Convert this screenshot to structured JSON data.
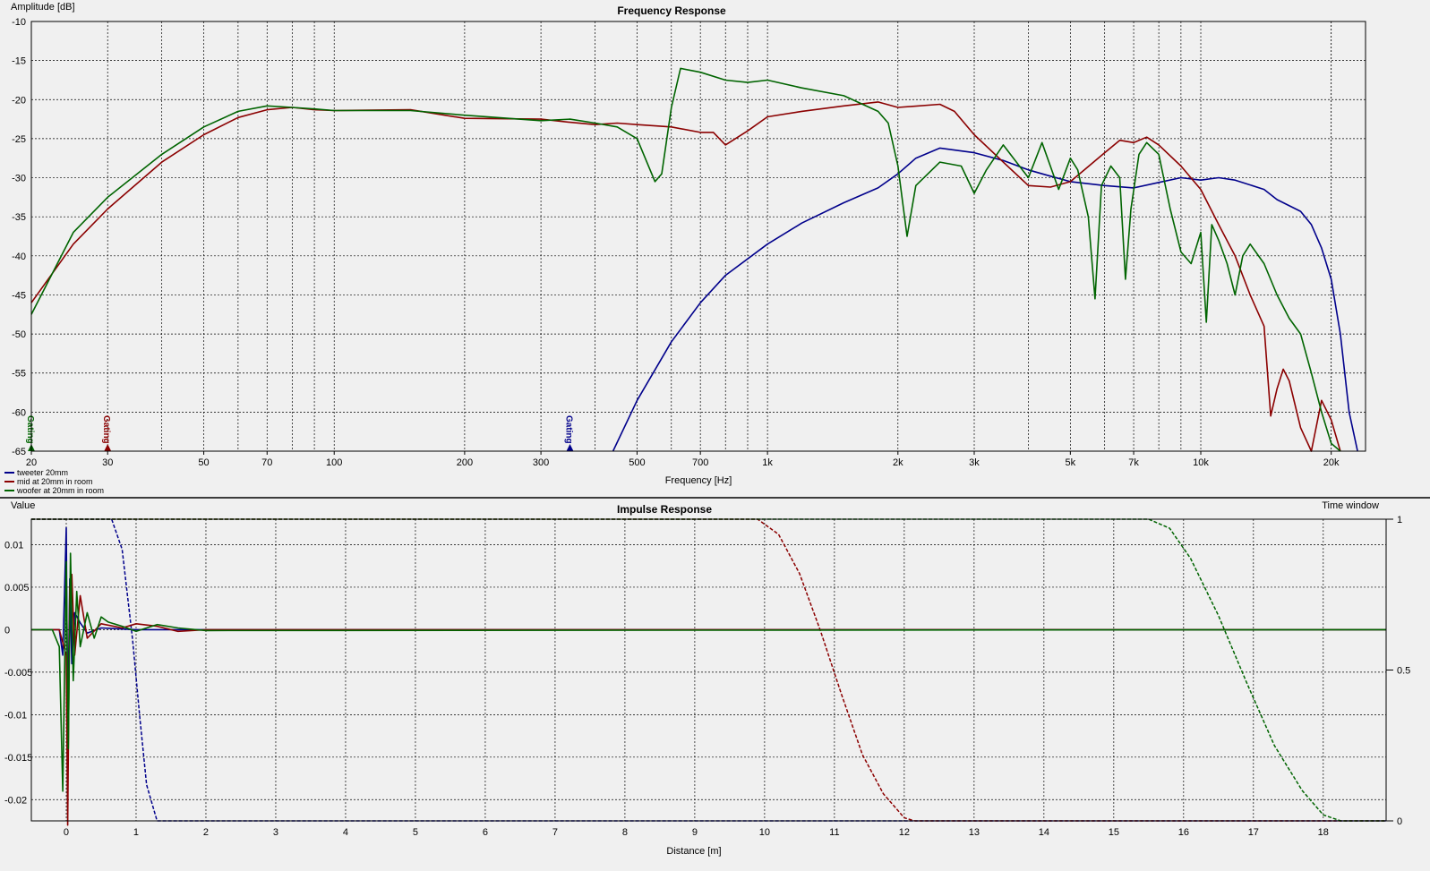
{
  "colors": {
    "tweeter": "#00008b",
    "mid": "#8b0000",
    "woofer": "#006400",
    "background": "#f0f0f0"
  },
  "chart_data": [
    {
      "type": "line",
      "title": "Frequency Response",
      "xlabel": "Frequency [Hz]",
      "ylabel": "Amplitude [dB]",
      "xscale": "log",
      "xlim": [
        20,
        24000
      ],
      "ylim": [
        -65,
        -10
      ],
      "xticks": [
        20,
        30,
        50,
        70,
        100,
        200,
        300,
        500,
        700,
        1000,
        2000,
        3000,
        5000,
        7000,
        10000,
        20000
      ],
      "xticklabels": [
        "20",
        "30",
        "50",
        "70",
        "100",
        "200",
        "300",
        "500",
        "700",
        "1k",
        "2k",
        "3k",
        "5k",
        "7k",
        "10k",
        "20k"
      ],
      "yticks": [
        -10,
        -15,
        -20,
        -25,
        -30,
        -35,
        -40,
        -45,
        -50,
        -55,
        -60,
        -65
      ],
      "grid": true,
      "legend_position": "bottom-left",
      "series": [
        {
          "name": "tweeter 20mm",
          "color": "#00008b",
          "x": [
            440,
            500,
            600,
            700,
            800,
            1000,
            1200,
            1500,
            1800,
            2000,
            2200,
            2500,
            3000,
            3500,
            4000,
            4500,
            5000,
            6000,
            7000,
            8000,
            9000,
            10000,
            11000,
            12000,
            14000,
            15000,
            17000,
            18000,
            19000,
            20000,
            21000,
            22000,
            23000
          ],
          "y": [
            -65,
            -58.5,
            -51,
            -46,
            -42.5,
            -38.5,
            -35.8,
            -33.2,
            -31.3,
            -29.5,
            -27.5,
            -26.2,
            -26.8,
            -27.8,
            -29,
            -29.8,
            -30.5,
            -31,
            -31.3,
            -30.6,
            -30,
            -30.3,
            -30,
            -30.3,
            -31.5,
            -32.8,
            -34.3,
            -36,
            -39,
            -43,
            -50,
            -60,
            -65
          ]
        },
        {
          "name": "mid at 20mm in room",
          "color": "#8b0000",
          "x": [
            20,
            25,
            30,
            40,
            50,
            60,
            70,
            80,
            90,
            100,
            150,
            200,
            300,
            350,
            400,
            450,
            500,
            600,
            700,
            750,
            800,
            900,
            1000,
            1200,
            1500,
            1800,
            2000,
            2500,
            2700,
            3000,
            3500,
            4000,
            4500,
            5000,
            6000,
            6500,
            7000,
            7500,
            8000,
            9000,
            10000,
            11000,
            12000,
            13000,
            14000,
            14500,
            15000,
            15500,
            16000,
            17000,
            18000,
            19000,
            20000,
            21000
          ],
          "y": [
            -46,
            -38.5,
            -34,
            -28,
            -24.5,
            -22.3,
            -21.3,
            -21,
            -21.3,
            -21.4,
            -21.3,
            -22.4,
            -22.5,
            -22.9,
            -23.2,
            -23,
            -23.2,
            -23.5,
            -24.2,
            -24.2,
            -25.8,
            -24,
            -22.2,
            -21.5,
            -20.8,
            -20.3,
            -21,
            -20.6,
            -21.5,
            -24.5,
            -28,
            -31,
            -31.2,
            -30.5,
            -26.8,
            -25.2,
            -25.5,
            -24.8,
            -25.8,
            -28.5,
            -31.5,
            -36,
            -40,
            -45,
            -49,
            -60.5,
            -57,
            -54.5,
            -56,
            -62,
            -65,
            -58.5,
            -61,
            -65
          ]
        },
        {
          "name": "woofer at 20mm in room",
          "color": "#006400",
          "x": [
            20,
            25,
            30,
            40,
            50,
            60,
            70,
            80,
            90,
            100,
            150,
            200,
            300,
            350,
            400,
            450,
            500,
            550,
            570,
            600,
            630,
            700,
            800,
            900,
            1000,
            1200,
            1500,
            1800,
            1900,
            2000,
            2100,
            2200,
            2500,
            2800,
            3000,
            3200,
            3500,
            4000,
            4300,
            4700,
            5000,
            5200,
            5500,
            5700,
            5900,
            6200,
            6500,
            6700,
            6900,
            7200,
            7500,
            8000,
            8500,
            9000,
            9500,
            10000,
            10300,
            10600,
            11000,
            11500,
            12000,
            12500,
            13000,
            14000,
            15000,
            16000,
            17000,
            18000,
            19000,
            20000,
            21000
          ],
          "y": [
            -47.5,
            -37,
            -32.5,
            -27,
            -23.5,
            -21.5,
            -20.8,
            -21,
            -21.2,
            -21.4,
            -21.4,
            -22,
            -22.7,
            -22.5,
            -23,
            -23.5,
            -25,
            -30.5,
            -29.5,
            -21,
            -16,
            -16.5,
            -17.5,
            -17.8,
            -17.5,
            -18.5,
            -19.5,
            -21.5,
            -23,
            -28.5,
            -37.5,
            -31,
            -28,
            -28.5,
            -32,
            -29,
            -25.8,
            -30,
            -25.5,
            -31.5,
            -27.5,
            -29,
            -35,
            -45.5,
            -31,
            -28.5,
            -30,
            -43,
            -34,
            -27,
            -25.5,
            -27,
            -34,
            -39.5,
            -41,
            -37,
            -48.5,
            -36,
            -38,
            -41,
            -45,
            -40,
            -38.5,
            -41,
            -45,
            -48,
            -50,
            -55,
            -60,
            -64,
            -65
          ]
        }
      ],
      "markers": [
        {
          "x": 20,
          "label": "Gating",
          "color": "#006400"
        },
        {
          "x": 30,
          "label": "Gating",
          "color": "#8b0000"
        },
        {
          "x": 350,
          "label": "Gating",
          "color": "#00008b"
        }
      ]
    },
    {
      "type": "line",
      "title": "Impulse Response",
      "xlabel": "Distance [m]",
      "ylabel": "Value",
      "y2label": "Time window",
      "xlim": [
        -0.5,
        18.9
      ],
      "ylim": [
        -0.0225,
        0.013
      ],
      "y2lim": [
        0,
        1
      ],
      "xticks": [
        0,
        1,
        2,
        3,
        4,
        5,
        6,
        7,
        8,
        9,
        10,
        11,
        12,
        13,
        14,
        15,
        16,
        17,
        18
      ],
      "yticks": [
        0.01,
        0.005,
        0,
        -0.005,
        -0.01,
        -0.015,
        -0.02
      ],
      "yticklabels": [
        "0.01",
        "0.005",
        "0",
        "-0.005",
        "-0.01",
        "-0.015",
        "-0.02"
      ],
      "y2ticks": [
        1,
        0.5,
        0
      ],
      "y2ticklabels": [
        "1",
        "0.5",
        "0"
      ],
      "grid": true,
      "series": [
        {
          "name": "tweeter 20mm",
          "color": "#00008b",
          "x": [
            -0.5,
            -0.1,
            -0.05,
            0,
            0.02,
            0.05,
            0.08,
            0.12,
            0.2,
            0.3,
            0.5,
            1.0,
            18.9
          ],
          "y": [
            0,
            0,
            -0.003,
            0.012,
            -0.012,
            0.006,
            -0.004,
            0.002,
            0.0008,
            -0.0004,
            0.0002,
            0,
            0
          ]
        },
        {
          "name": "mid at 20mm in room",
          "color": "#8b0000",
          "x": [
            -0.5,
            -0.1,
            0,
            0.02,
            0.05,
            0.08,
            0.12,
            0.2,
            0.3,
            0.5,
            0.8,
            1.0,
            1.3,
            1.6,
            2.0,
            18.9
          ],
          "y": [
            0,
            0,
            -0.003,
            -0.023,
            0.005,
            0.0065,
            -0.003,
            0.004,
            -0.001,
            0.0007,
            0.0002,
            0.0007,
            0.0004,
            -0.0002,
            0,
            0
          ]
        },
        {
          "name": "woofer at 20mm in room",
          "color": "#006400",
          "x": [
            -0.5,
            -0.2,
            -0.1,
            -0.05,
            0,
            0.03,
            0.06,
            0.1,
            0.15,
            0.2,
            0.3,
            0.4,
            0.5,
            0.6,
            0.8,
            1.0,
            1.3,
            1.6,
            2.0,
            18.9
          ],
          "y": [
            0,
            0,
            -0.002,
            -0.019,
            0.008,
            -0.014,
            0.009,
            -0.006,
            0.0045,
            -0.002,
            0.002,
            -0.001,
            0.0015,
            0.0009,
            0.0004,
            -0.0002,
            0.0006,
            0.0002,
            -0.0001,
            0
          ]
        }
      ],
      "time_windows": [
        {
          "name": "tweeter 20mm",
          "color": "#00008b",
          "x": [
            -0.5,
            0.65,
            0.8,
            0.95,
            1.05,
            1.15,
            1.3,
            18.9
          ],
          "y": [
            1,
            1,
            0.9,
            0.6,
            0.35,
            0.12,
            0,
            0
          ]
        },
        {
          "name": "mid at 20mm in room",
          "color": "#8b0000",
          "x": [
            -0.5,
            9.9,
            10.2,
            10.5,
            10.8,
            11.1,
            11.4,
            11.7,
            12.0,
            12.15,
            18.9
          ],
          "y": [
            1,
            1,
            0.95,
            0.82,
            0.63,
            0.42,
            0.22,
            0.09,
            0.01,
            0,
            0
          ]
        },
        {
          "name": "woofer at 20mm in room",
          "color": "#006400",
          "x": [
            -0.5,
            15.5,
            15.8,
            16.1,
            16.5,
            16.9,
            17.3,
            17.7,
            18.0,
            18.25,
            18.9
          ],
          "y": [
            1,
            1,
            0.97,
            0.87,
            0.68,
            0.46,
            0.25,
            0.1,
            0.02,
            0,
            0
          ]
        }
      ]
    }
  ]
}
